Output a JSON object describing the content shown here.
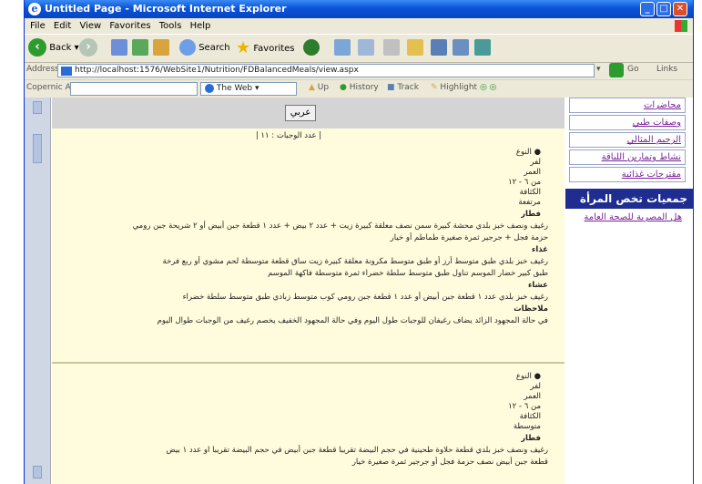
{
  "window": {
    "title": "Untitled Page - Microsoft Internet Explorer"
  },
  "menu": [
    "File",
    "Edit",
    "View",
    "Favorites",
    "Tools",
    "Help"
  ],
  "toolbar": {
    "back": "Back",
    "search": "Search",
    "favorites": "Favorites"
  },
  "address": {
    "label": "Address",
    "url": "http://localhost:1576/WebSite1/Nutrition/FDBalancedMeals/view.aspx",
    "go": "Go",
    "links": "Links"
  },
  "links_bar": {
    "label": "Copernic Agent",
    "search_engine": "The Web",
    "up": "Up",
    "history": "History",
    "track": "Track",
    "highlight": "Highlight"
  },
  "main": {
    "button_label": "عربي",
    "count": "| عدد الوجبات : ١١ |",
    "block1": {
      "type": "النوع",
      "name": "لفر",
      "age_label": "العمر",
      "age": "من ٦ - ١٢",
      "weight_label": "الكثافة",
      "weight": "مرتفعة",
      "meal": "فطار",
      "lines": [
        "رغيف ونصف خبز بلدي محشة كبيرة سمن نصف معلقة كبيرة زيت + عدد ٢ بيض + عدد ١ قطعة جبن أبيض أو ٢ شريحة جبن رومي",
        "حزمة فجل + جرجير ثمرة صغيرة طماطم أو خيار",
        "غذاء",
        "رغيف خبز بلدي طبق متوسط أرز أو طبق متوسط مكرونة معلقة كبيرة زيت ساق قطعة متوسطة لحم مشوي أو ربع فرخة",
        "طبق كبير خضار الموسم تناول طبق متوسط سلطة خضراء ثمرة متوسطة فاكهة الموسم",
        "عشاء",
        "رغيف خبز بلدي عدد ١ قطعة جبن أبيض أو عدد ١ قطعة جبن رومي كوب متوسط زبادي طبق متوسط سلطة خضراء",
        "ملاحظات",
        "في حالة المجهود الزائد يضاف رغيفان للوجبات طول اليوم وفي حالة المجهود الخفيف يخصم رغيف من الوجبات طوال اليوم"
      ]
    },
    "block2": {
      "type": "النوع",
      "name": "لفر",
      "age_label": "العمر",
      "age": "من ٦ - ١٢",
      "weight_label": "الكثافة",
      "weight": "متوسطة",
      "meal": "فطار",
      "lines": [
        "رغيف ونصف خبز بلدي قطعة حلاوة طحينية في حجم البيضة تقريبا قطعة جبن أبيض في حجم البيضة تقريبا او عدد ١ بيض",
        "قطعة جبن أبيض نصف حزمة فجل أو جرجير ثمرة صغيرة خيار"
      ]
    }
  },
  "sidebar": {
    "links": [
      "محاضرات",
      "وصفات طبي",
      "الرجيم المثالي",
      "نشاط وتمارين اللياقة",
      "مقترحات غذائية"
    ],
    "heading": "جمعيات تخص المرأة",
    "sub_link": "هل المصرية للصحة العامة"
  }
}
